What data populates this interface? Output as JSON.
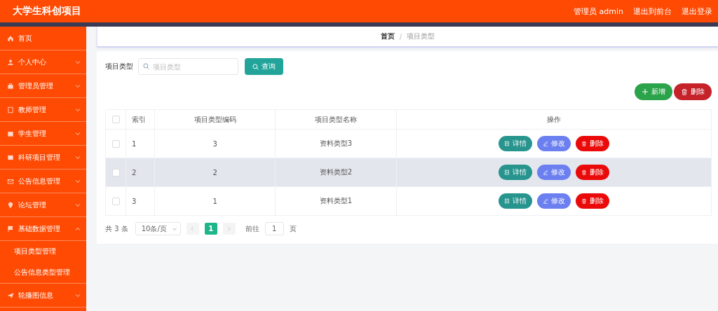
{
  "header": {
    "title": "大学生科创项目",
    "links": [
      "管理员 admin",
      "退出到前台",
      "退出登录"
    ]
  },
  "sidebar": {
    "items": [
      {
        "label": "首页",
        "kind": "link"
      },
      {
        "label": "个人中心",
        "kind": "menu",
        "expanded": false
      },
      {
        "label": "管理员管理",
        "kind": "menu",
        "expanded": false
      },
      {
        "label": "教师管理",
        "kind": "menu",
        "expanded": false
      },
      {
        "label": "学生管理",
        "kind": "menu",
        "expanded": false
      },
      {
        "label": "科研项目管理",
        "kind": "menu",
        "expanded": false
      },
      {
        "label": "公告信息管理",
        "kind": "menu",
        "expanded": false
      },
      {
        "label": "论坛管理",
        "kind": "menu",
        "expanded": false
      },
      {
        "label": "基础数据管理",
        "kind": "menu",
        "expanded": true,
        "children": [
          {
            "label": "项目类型管理"
          },
          {
            "label": "公告信息类型管理"
          }
        ]
      },
      {
        "label": "轮播图信息",
        "kind": "menu",
        "expanded": false
      }
    ]
  },
  "breadcrumb": {
    "items": [
      "首页",
      "项目类型"
    ],
    "separator": "/"
  },
  "search": {
    "label": "项目类型",
    "placeholder": "项目类型",
    "button": "查询"
  },
  "actions": [
    {
      "label": "新增",
      "kind": "add"
    },
    {
      "label": "删除",
      "kind": "delete"
    }
  ],
  "table": {
    "all_checked": false,
    "columns": [
      "索引",
      "项目类型编码",
      "项目类型名称",
      "操作"
    ],
    "rows": [
      {
        "checked": false,
        "highlighted": false,
        "cells": [
          "1",
          "3",
          "资料类型3"
        ],
        "buttons": [
          {
            "label": "详情",
            "kind": "detail"
          },
          {
            "label": "修改",
            "kind": "edit"
          },
          {
            "label": "删除",
            "kind": "delete"
          }
        ]
      },
      {
        "checked": false,
        "highlighted": true,
        "cells": [
          "2",
          "2",
          "资料类型2"
        ],
        "buttons": [
          {
            "label": "详情",
            "kind": "detail"
          },
          {
            "label": "修改",
            "kind": "edit"
          },
          {
            "label": "删除",
            "kind": "delete"
          }
        ]
      },
      {
        "checked": false,
        "highlighted": false,
        "cells": [
          "3",
          "1",
          "资料类型1"
        ],
        "buttons": [
          {
            "label": "详情",
            "kind": "detail"
          },
          {
            "label": "修改",
            "kind": "edit"
          },
          {
            "label": "删除",
            "kind": "delete"
          }
        ]
      }
    ]
  },
  "pagination": {
    "total": "共 3 条",
    "page_size": "10条/页",
    "pages": [
      {
        "label": "1",
        "selected": true
      }
    ],
    "goto_label": "前往",
    "goto_value": "1",
    "goto_suffix": "页"
  }
}
